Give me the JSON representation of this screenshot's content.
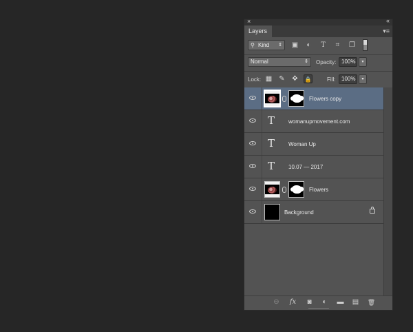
{
  "panel": {
    "close_glyph": "×",
    "collapse_glyph": "‹‹",
    "tab_label": "Layers",
    "menu_glyph": "▾≡"
  },
  "filter": {
    "kind_icon": "⚲",
    "kind_label": "Kind",
    "kind_arrow": "⇕",
    "icons": [
      "image-filter-icon",
      "adjustment-filter-icon",
      "type-filter-icon",
      "shape-filter-icon",
      "smart-object-filter-icon"
    ],
    "icon_glyphs": [
      "▣",
      "◐",
      "T",
      "⌗",
      "❐"
    ]
  },
  "blend": {
    "mode": "Normal",
    "arrow": "⇕",
    "opacity_label": "Opacity:",
    "opacity_value": "100%",
    "spin_glyph": "▾"
  },
  "lock": {
    "label": "Lock:",
    "icon_glyphs": [
      "▦",
      "✎",
      "✥",
      "🔒"
    ],
    "fill_label": "Fill:",
    "fill_value": "100%",
    "spin_glyph": "▾"
  },
  "layers": [
    {
      "name": "Flowers copy",
      "type": "image-mask",
      "selected": true
    },
    {
      "name": "womanupmovement.com",
      "type": "text",
      "selected": false
    },
    {
      "name": "Woman Up",
      "type": "text",
      "selected": false
    },
    {
      "name": "10.07 — 2017",
      "type": "text",
      "selected": false
    },
    {
      "name": "Flowers",
      "type": "image-mask",
      "selected": false
    },
    {
      "name": "Background",
      "type": "background",
      "selected": false,
      "locked": true
    }
  ],
  "text_layer_glyph": "T",
  "colors": {
    "app_background": "#262626",
    "panel": "#535353",
    "selected_layer": "#5b6d84"
  },
  "bottom_icons": {
    "link": "⊖",
    "fx": "fx",
    "mask": "◙",
    "adjustment": "◐",
    "group": "▬",
    "new_layer": "▤",
    "delete": "🗑"
  }
}
